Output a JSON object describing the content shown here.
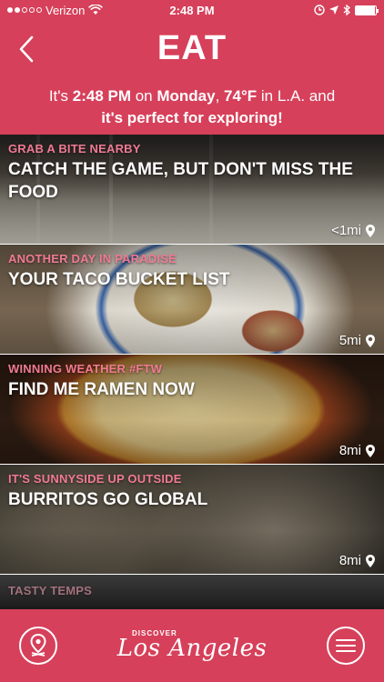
{
  "status_bar": {
    "carrier": "Verizon",
    "time": "2:48 PM",
    "signal_filled": 2,
    "signal_total": 5,
    "battery_level": 0.95
  },
  "header": {
    "title": "EAT",
    "line1_prefix": "It's ",
    "time": "2:48 PM",
    "line1_on": " on ",
    "day": "Monday",
    "line1_comma": ", ",
    "temp": "74°F",
    "line1_suffix": " in L.A. and",
    "line2": "it's perfect for exploring!"
  },
  "cards": [
    {
      "kicker": "GRAB A BITE NEARBY",
      "title": "CATCH THE GAME, BUT DON'T MISS THE FOOD",
      "distance": "<1mi"
    },
    {
      "kicker": "ANOTHER DAY IN PARADISE",
      "title": "YOUR TACO BUCKET LIST",
      "distance": "5mi"
    },
    {
      "kicker": "WINNING WEATHER #FTW",
      "title": "FIND ME RAMEN NOW",
      "distance": "8mi"
    },
    {
      "kicker": "IT'S SUNNYSIDE UP OUTSIDE",
      "title": "BURRITOS GO GLOBAL",
      "distance": "8mi"
    },
    {
      "kicker": "TASTY TEMPS"
    }
  ],
  "footer": {
    "logo_top": "DISCOVER",
    "logo_script": "Los Angeles"
  },
  "colors": {
    "brand": "#d6405a",
    "kicker": "#f07a93"
  },
  "icons": {
    "back": "chevron-left-icon",
    "location": "location-pin-icon",
    "map": "map-pin-icon",
    "menu": "hamburger-menu-icon"
  }
}
